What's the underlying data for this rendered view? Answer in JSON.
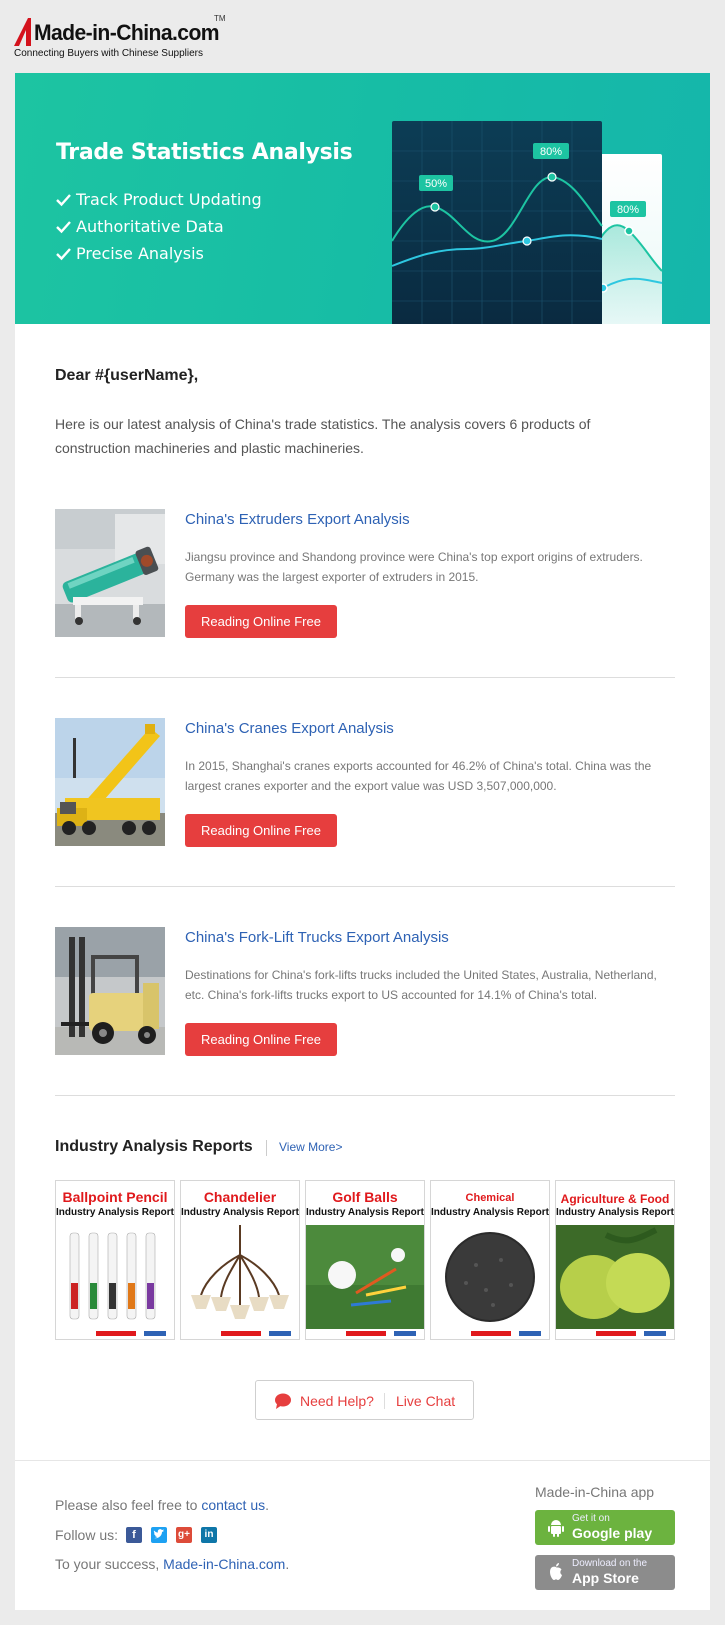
{
  "header": {
    "logo_text": "Made-in-China.com",
    "logo_tm": "TM",
    "tagline": "Connecting Buyers with Chinese Suppliers"
  },
  "hero": {
    "title": "Trade Statistics Analysis",
    "items": [
      "Track Product Updating",
      "Authoritative Data",
      "Precise Analysis"
    ],
    "chart_labels": [
      "50%",
      "80%",
      "80%"
    ]
  },
  "greeting": "Dear #{userName},",
  "intro": "Here is our latest analysis of China's trade statistics. The analysis covers 6 products of construction machineries and plastic machineries.",
  "articles": [
    {
      "title": "China's Extruders Export Analysis",
      "desc": "Jiangsu province and Shandong province were China's top export origins of extruders. Germany was the largest exporter of extruders in 2015.",
      "button": "Reading Online Free"
    },
    {
      "title": "China's Cranes Export Analysis",
      "desc": "In 2015, Shanghai's cranes exports accounted for 46.2% of China's total. China was the largest cranes exporter and the export value was USD 3,507,000,000.",
      "button": "Reading Online Free"
    },
    {
      "title": "China's Fork-Lift Trucks Export Analysis",
      "desc": "Destinations for China's fork-lifts trucks included the United States, Australia, Netherland, etc. China's fork-lifts trucks export to US accounted for 14.1% of China's total.",
      "button": "Reading Online Free"
    }
  ],
  "reports": {
    "title": "Industry Analysis Reports",
    "view_more": "View More>",
    "subtitle": "Industry Analysis Report",
    "items": [
      "Ballpoint Pencil",
      "Chandelier",
      "Golf Balls",
      "Chemical",
      "Agriculture & Food"
    ]
  },
  "help": {
    "need_help": "Need Help?",
    "live_chat": "Live Chat"
  },
  "footer": {
    "contact_prefix": "Please also feel free to ",
    "contact_link": "contact us",
    "contact_suffix": ".",
    "follow": "Follow us:",
    "success_prefix": "To your success, ",
    "success_link": "Made-in-China.com",
    "success_suffix": ".",
    "app_label": "Made-in-China app",
    "google_small": "Get it on",
    "google_big": "Google play",
    "apple_small": "Download on the",
    "apple_big": "App Store"
  },
  "colors": {
    "hero_teal": "#17bda5",
    "link_blue": "#2e62b4",
    "button_red": "#e63e3e",
    "google_green": "#6cb33f",
    "apple_gray": "#8c8c8c"
  }
}
